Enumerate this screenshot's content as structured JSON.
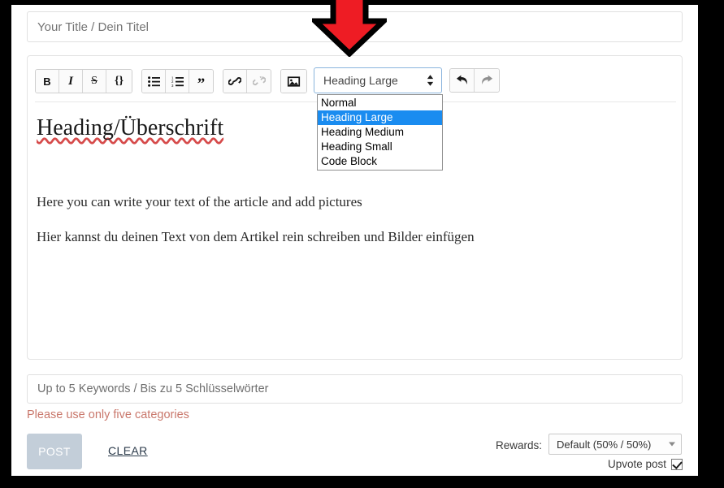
{
  "title_field": {
    "placeholder": "Your Title / Dein Titel",
    "value": ""
  },
  "toolbar": {
    "groups": [
      {
        "name": "text-format",
        "buttons": [
          {
            "name": "bold-button",
            "icon": "bold-icon",
            "glyph": "B",
            "disabled": false
          },
          {
            "name": "italic-button",
            "icon": "italic-icon",
            "glyph": "I",
            "disabled": false
          },
          {
            "name": "strikethrough-button",
            "icon": "strikethrough-icon",
            "glyph": "S",
            "disabled": false
          },
          {
            "name": "code-button",
            "icon": "code-braces-icon",
            "glyph": "{}",
            "disabled": false
          }
        ]
      },
      {
        "name": "list-format",
        "buttons": [
          {
            "name": "bullet-list-button",
            "icon": "bullet-list-icon",
            "glyph": "",
            "disabled": false
          },
          {
            "name": "numbered-list-button",
            "icon": "numbered-list-icon",
            "glyph": "",
            "disabled": false
          },
          {
            "name": "blockquote-button",
            "icon": "quote-icon",
            "glyph": "”",
            "disabled": false
          }
        ]
      },
      {
        "name": "link-media",
        "buttons": [
          {
            "name": "link-button",
            "icon": "link-icon",
            "glyph": "",
            "disabled": false
          },
          {
            "name": "unlink-button",
            "icon": "unlink-icon",
            "glyph": "",
            "disabled": true
          }
        ]
      },
      {
        "name": "media",
        "buttons": [
          {
            "name": "image-button",
            "icon": "image-icon",
            "glyph": "",
            "disabled": false
          }
        ]
      }
    ],
    "history": [
      {
        "name": "undo-button",
        "icon": "undo-arrow-icon",
        "disabled": false
      },
      {
        "name": "redo-button",
        "icon": "redo-arrow-icon",
        "disabled": true
      }
    ]
  },
  "format_select": {
    "selected": "Heading Large",
    "expanded": true,
    "highlight_color": "#1a8cf0",
    "options": [
      "Normal",
      "Heading Large",
      "Heading Medium",
      "Heading Small",
      "Code Block"
    ]
  },
  "editor": {
    "heading": "Heading/Überschrift",
    "paragraph_1": "Here you can write your text of the article and add pictures",
    "paragraph_2": "Hier kannst du deinen Text von dem Artikel rein schreiben und Bilder einfügen",
    "spellcheck_underline_color": "#d64b4b"
  },
  "keywords_field": {
    "placeholder": "Up to 5 Keywords / Bis zu 5 Schlüsselwörter",
    "value": ""
  },
  "warning": {
    "text": "Please use only five categories",
    "color": "#c9776b"
  },
  "footer": {
    "post_label": "POST",
    "post_disabled": true,
    "post_color": "#c3ced9",
    "clear_label": "CLEAR",
    "rewards_label": "Rewards:",
    "rewards_value": "Default (50% / 50%)",
    "upvote_label": "Upvote post",
    "upvote_checked": true
  },
  "annotation": {
    "arrow": "red-down-arrow",
    "fill": "#ee1c24",
    "stroke": "#000000"
  }
}
